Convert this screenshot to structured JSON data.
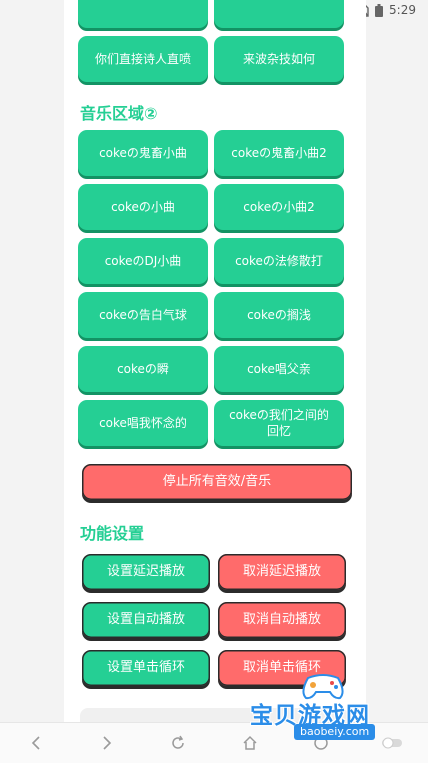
{
  "status": {
    "time": "5:29"
  },
  "top_buttons": [
    {
      "label": "你们直接诗人直喷"
    },
    {
      "label": "来波杂技如何"
    }
  ],
  "music_section": {
    "title": "音乐区域②",
    "buttons": [
      {
        "label": "cokeの鬼畜小曲"
      },
      {
        "label": "cokeの鬼畜小曲2"
      },
      {
        "label": "cokeの小曲"
      },
      {
        "label": "cokeの小曲2"
      },
      {
        "label": "cokeのDJ小曲"
      },
      {
        "label": "cokeの法修散打"
      },
      {
        "label": "cokeの告白气球"
      },
      {
        "label": "cokeの搁浅"
      },
      {
        "label": "cokeの瞬"
      },
      {
        "label": "coke唱父亲"
      },
      {
        "label": "coke唱我怀念的"
      },
      {
        "label": "cokeの我们之间的回忆"
      }
    ]
  },
  "stop_all": {
    "label": "停止所有音效/音乐"
  },
  "settings_section": {
    "title": "功能设置",
    "rows": [
      {
        "set": "设置延迟播放",
        "cancel": "取消延迟播放"
      },
      {
        "set": "设置自动播放",
        "cancel": "取消自动播放"
      },
      {
        "set": "设置单击循环",
        "cancel": "取消单击循环"
      }
    ]
  },
  "watermark": {
    "title": "宝贝游戏网",
    "url": "baobeiy.com"
  },
  "colors": {
    "accent": "#25cf94",
    "danger": "#ff6b6b"
  }
}
